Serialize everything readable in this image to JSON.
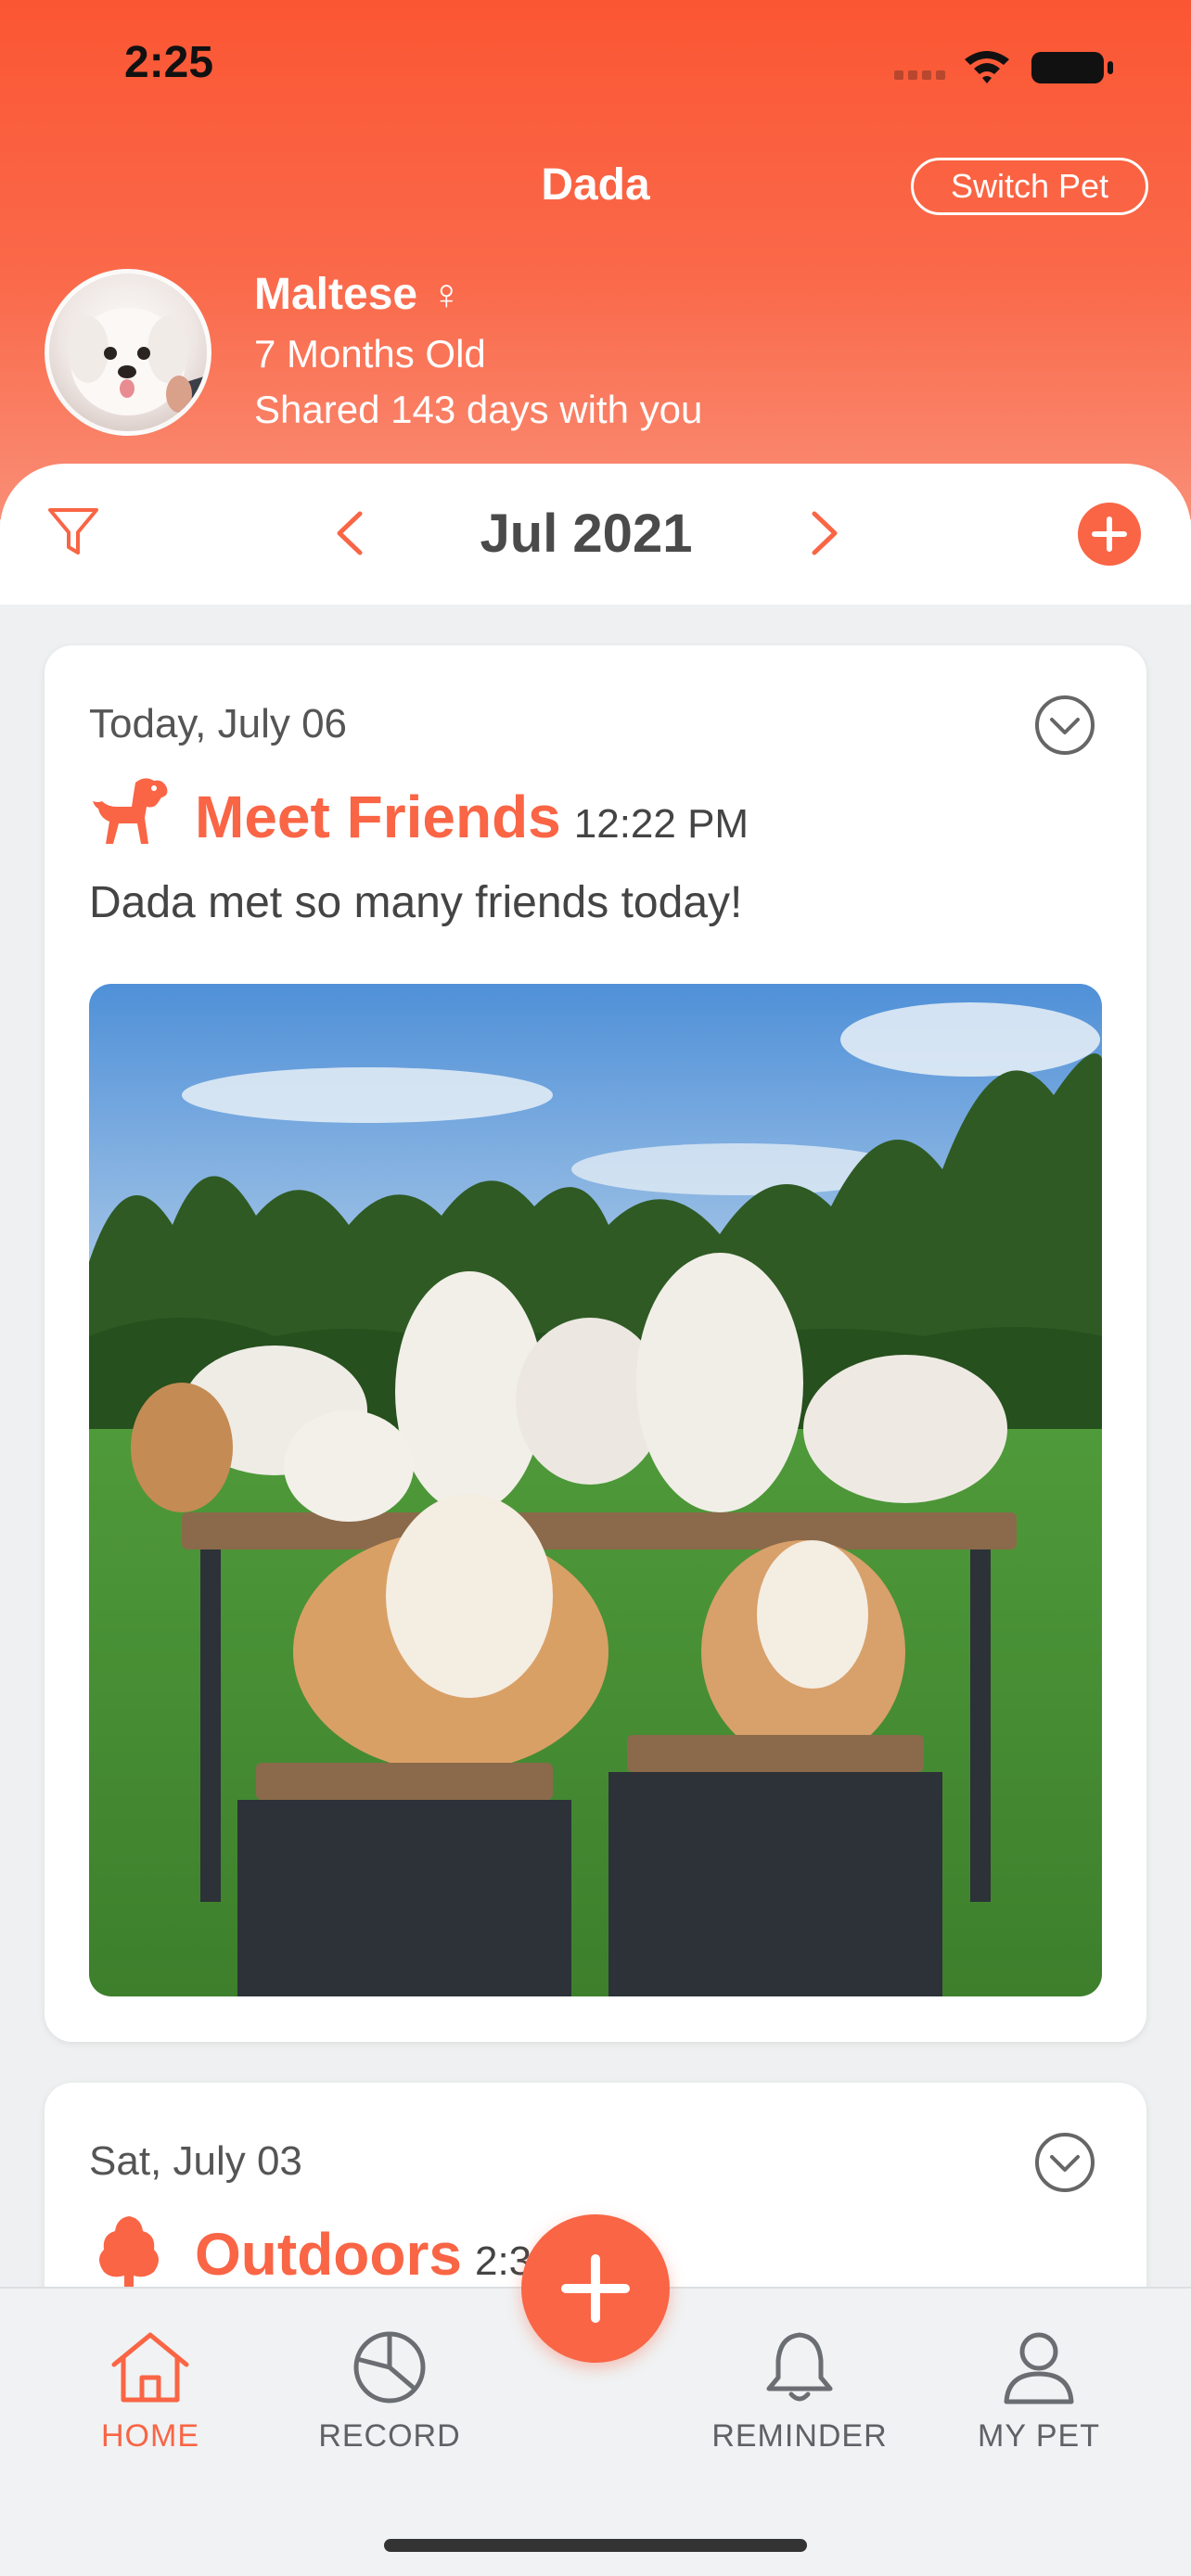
{
  "status_bar": {
    "time": "2:25"
  },
  "nav": {
    "title": "Dada",
    "switch_pet_label": "Switch Pet"
  },
  "pet": {
    "breed": "Maltese",
    "gender_symbol": "♀",
    "age": "7 Months Old",
    "days_shared": "Shared 143 days with you"
  },
  "month_bar": {
    "label": "Jul 2021"
  },
  "entries": [
    {
      "date": "Today, July 06",
      "category": "Meet Friends",
      "time": "12:22 PM",
      "description": "Dada met so many friends today!",
      "icon": "dog-icon"
    },
    {
      "date": "Sat, July 03",
      "category": "Outdoors",
      "time": "2:3",
      "icon": "tree-icon"
    }
  ],
  "tabs": [
    {
      "label": "HOME",
      "icon": "home-icon",
      "active": true
    },
    {
      "label": "RECORD",
      "icon": "pie-chart-icon",
      "active": false
    },
    {
      "label": "REMINDER",
      "icon": "bell-icon",
      "active": false
    },
    {
      "label": "MY PET",
      "icon": "user-icon",
      "active": false
    }
  ],
  "colors": {
    "accent": "#f96545",
    "header": "#fb5633"
  }
}
